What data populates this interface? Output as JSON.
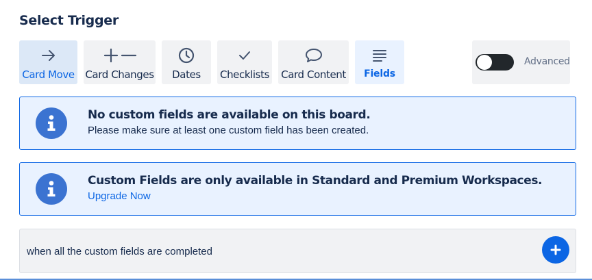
{
  "header": {
    "title": "Select Trigger"
  },
  "tabs": [
    {
      "label": "Card Move",
      "icon": "arrow-right-icon"
    },
    {
      "label": "Card Changes",
      "icon": "plus-minus-icon"
    },
    {
      "label": "Dates",
      "icon": "clock-icon"
    },
    {
      "label": "Checklists",
      "icon": "checkmark-icon"
    },
    {
      "label": "Card Content",
      "icon": "speech-bubble-icon"
    },
    {
      "label": "Fields",
      "icon": "lines-icon"
    }
  ],
  "advanced": {
    "label": "Advanced",
    "enabled": true
  },
  "notices": [
    {
      "title": "No custom fields are available on this board.",
      "body": "Please make sure at least one custom field has been created."
    },
    {
      "title": "Custom Fields are only available in Standard and Premium Workspaces.",
      "link": "Upgrade Now"
    }
  ],
  "trigger": {
    "text": "when all the custom fields are completed"
  },
  "colors": {
    "accent": "#0c66e4",
    "info_circle": "#3b73d1",
    "notice_bg": "#e9f2ff",
    "toggle_on": "#22272b"
  }
}
